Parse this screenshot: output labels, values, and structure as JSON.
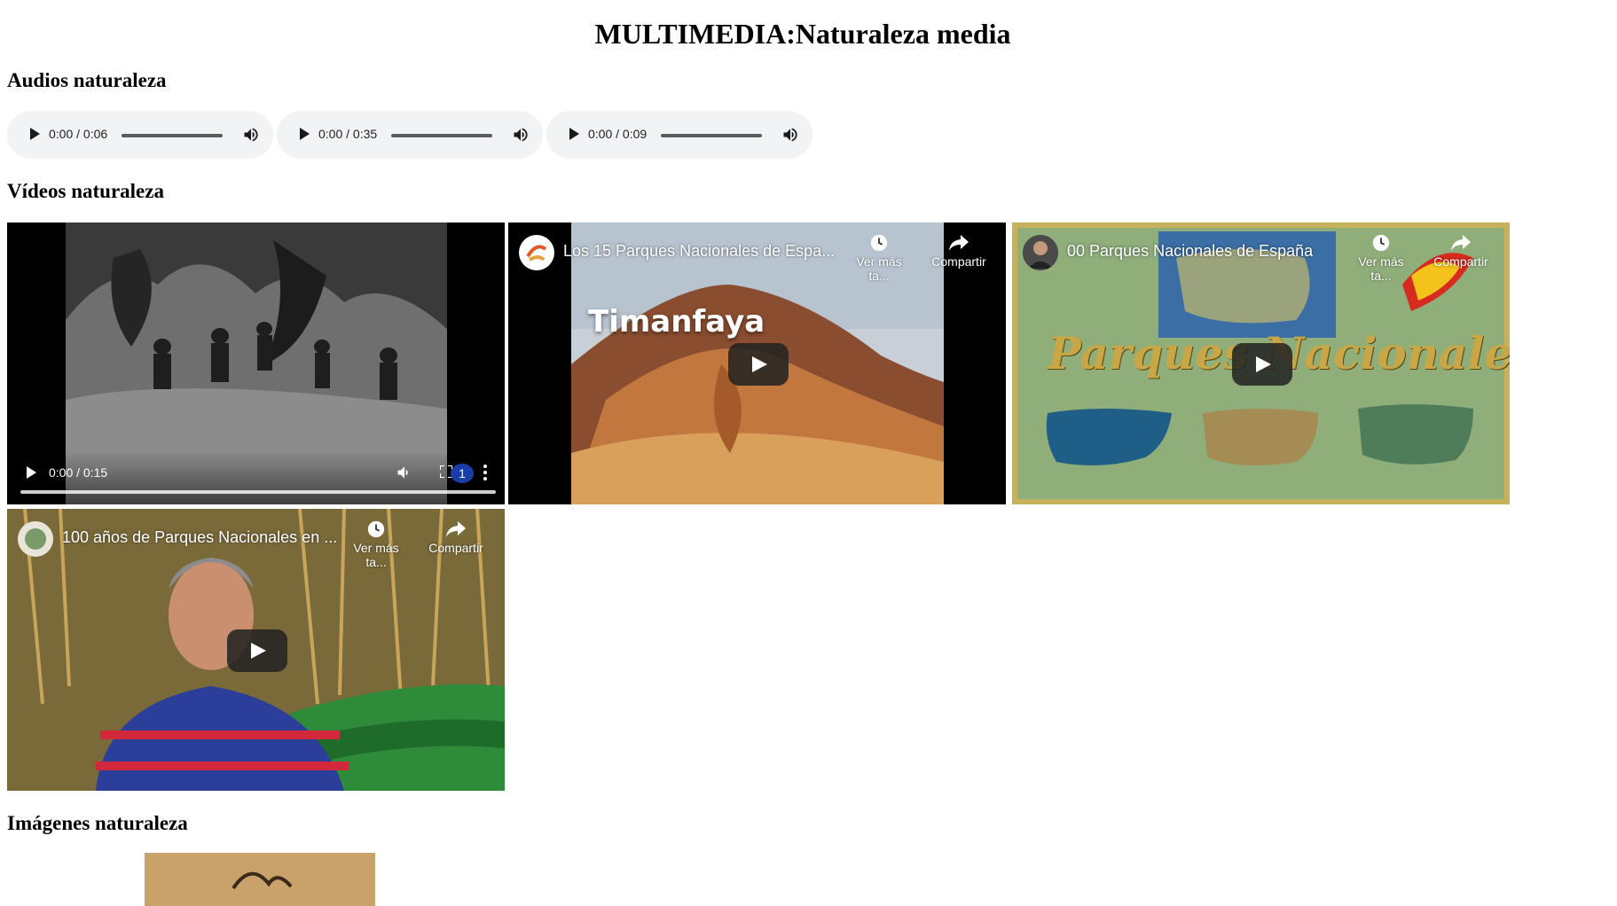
{
  "page": {
    "title": "MULTIMEDIA:Naturaleza media"
  },
  "sections": {
    "audios_heading": "Audios naturaleza",
    "videos_heading": "Vídeos naturaleza",
    "images_heading": "Imágenes naturaleza"
  },
  "audios": [
    {
      "time": "0:00 / 0:06"
    },
    {
      "time": "0:00 / 0:35"
    },
    {
      "time": "0:00 / 0:09"
    }
  ],
  "videos": {
    "native": {
      "time": "0:00 / 0:15",
      "badge": "1",
      "icons": [
        "play-icon",
        "volume-icon",
        "fullscreen-icon",
        "more-vertical-icon"
      ]
    },
    "embeds": [
      {
        "title": "Los 15 Parques Nacionales de Espa...",
        "overlay_text": "Timanfaya",
        "watch_later": "Ver más ta...",
        "share": "Compartir"
      },
      {
        "title": "00 Parques Nacionales de España",
        "overlay_text": "Parques Nacionales de España",
        "watch_later": "Ver más ta...",
        "share": "Compartir"
      },
      {
        "title": "100 años de Parques Nacionales en ...",
        "watch_later": "Ver más ta...",
        "share": "Compartir"
      }
    ]
  },
  "colors": {
    "audio_bg": "#f1f3f4",
    "youtube_play_bg": "#212121",
    "page_bg": "#ffffff"
  }
}
